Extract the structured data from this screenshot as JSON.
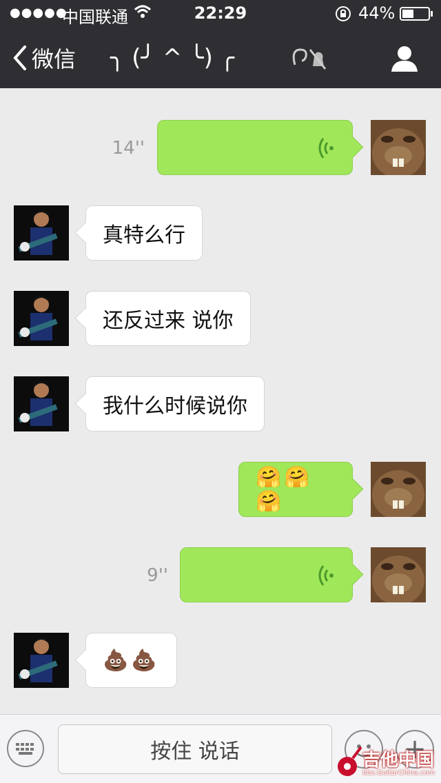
{
  "status": {
    "carrier": "中国联通",
    "time": "22:29",
    "battery_text": "44%",
    "battery_level": 0.44
  },
  "nav": {
    "back_label": "微信",
    "title": "╮ (╯ ^ ╰) ╭"
  },
  "messages": [
    {
      "side": "right",
      "type": "voice",
      "duration": "14''"
    },
    {
      "side": "left",
      "type": "text",
      "text": "真特么行"
    },
    {
      "side": "left",
      "type": "text",
      "text": "还反过来 说你"
    },
    {
      "side": "left",
      "type": "text",
      "text": "我什么时候说你"
    },
    {
      "side": "right",
      "type": "emoji",
      "text": "🤗🤗🤗"
    },
    {
      "side": "right",
      "type": "voice",
      "duration": "9''"
    },
    {
      "side": "left",
      "type": "emoji",
      "text": "💩💩"
    }
  ],
  "input": {
    "hold_to_talk": "按住 说话"
  },
  "watermark": {
    "title": "吉他中国",
    "subtitle": "bbs.GuitarChina.com"
  },
  "colors": {
    "header_bg": "#2f2f33",
    "outgoing_bubble": "#a0e75a",
    "incoming_bubble": "#ffffff",
    "chat_bg": "#ebebeb"
  }
}
